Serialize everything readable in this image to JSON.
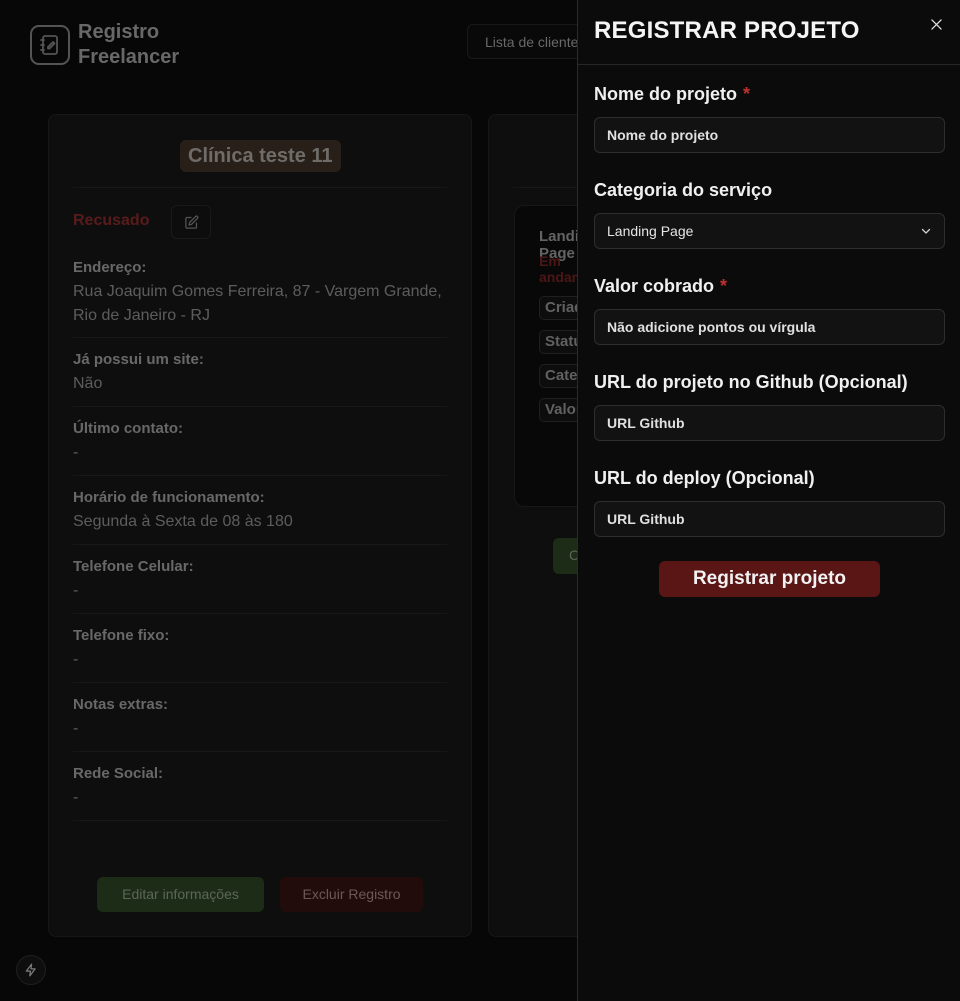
{
  "app": {
    "brand_line1": "Registro",
    "brand_line2": "Freelancer",
    "nav_button": "Lista de clientes"
  },
  "client_card": {
    "title": "Clínica teste 11",
    "status": "Recusado",
    "fields": [
      {
        "label": "Endereço:",
        "value": "Rua Joaquim Gomes Ferreira, 87 - Vargem Grande, Rio de Janeiro - RJ"
      },
      {
        "label": "Já possui um site:",
        "value": "Não"
      },
      {
        "label": "Último contato:",
        "value": "-"
      },
      {
        "label": "Horário de funcionamento:",
        "value": "Segunda à Sexta de 08 às 180"
      },
      {
        "label": "Telefone Celular:",
        "value": "-"
      },
      {
        "label": "Telefone fixo:",
        "value": "-"
      },
      {
        "label": "Notas extras:",
        "value": "-"
      },
      {
        "label": "Rede Social:",
        "value": "-"
      }
    ],
    "edit_button": "Editar informações",
    "delete_button": "Excluir Registro"
  },
  "project_card": {
    "title": "Landing Page",
    "status": "Em andamento",
    "chips": [
      "Criado",
      "Status",
      "Categoria",
      "Valor"
    ],
    "button": "Concluir"
  },
  "drawer": {
    "title": "REGISTRAR PROJETO",
    "fields": {
      "name": {
        "label": "Nome do projeto",
        "placeholder": "Nome do projeto",
        "required": "*"
      },
      "category": {
        "label": "Categoria do serviço",
        "value": "Landing Page"
      },
      "price": {
        "label": "Valor cobrado",
        "placeholder": "Não adicione pontos ou vírgula",
        "required": "*"
      },
      "github": {
        "label": "URL do projeto no Github (Opcional)",
        "placeholder": "URL Github"
      },
      "deploy": {
        "label": "URL do deploy (Opcional)",
        "placeholder": "URL Github"
      }
    },
    "submit": "Registrar projeto"
  },
  "colors": {
    "accent_red": "#5a1515",
    "required_red": "#c03030",
    "status_red": "#a13232",
    "green": "#34502a"
  }
}
